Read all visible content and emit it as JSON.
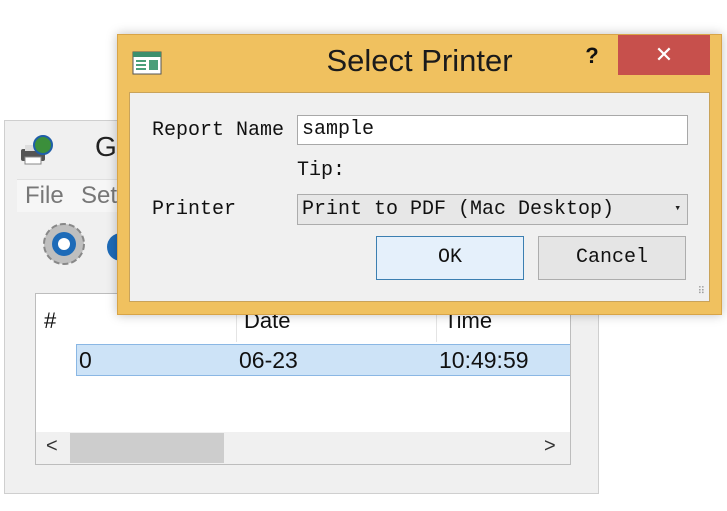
{
  "background_window": {
    "title_partial": "G",
    "menu": [
      "File",
      "Set"
    ],
    "toolbar": [
      {
        "icon": "settings-gear-icon"
      },
      {
        "icon": "globe-icon"
      }
    ],
    "table": {
      "headers": [
        "#",
        "Date",
        "Time"
      ],
      "rows": [
        {
          "num": "0",
          "date": "06-23",
          "time": "10:49:59"
        }
      ]
    },
    "scroll_left": "<",
    "scroll_right": ">"
  },
  "dialog": {
    "title": "Select Printer",
    "help": "?",
    "close": "✕",
    "report_name_label": "Report Name",
    "report_name_value": "sample",
    "tip_label": "Tip:",
    "printer_label": "Printer",
    "printer_selected": "Print to PDF (Mac Desktop)",
    "ok_label": "OK",
    "cancel_label": "Cancel"
  },
  "colors": {
    "dialog_frame": "#f0c15f",
    "close_button": "#c7504c",
    "selected_row": "#cde3f7",
    "default_button_border": "#3c7fb1"
  }
}
